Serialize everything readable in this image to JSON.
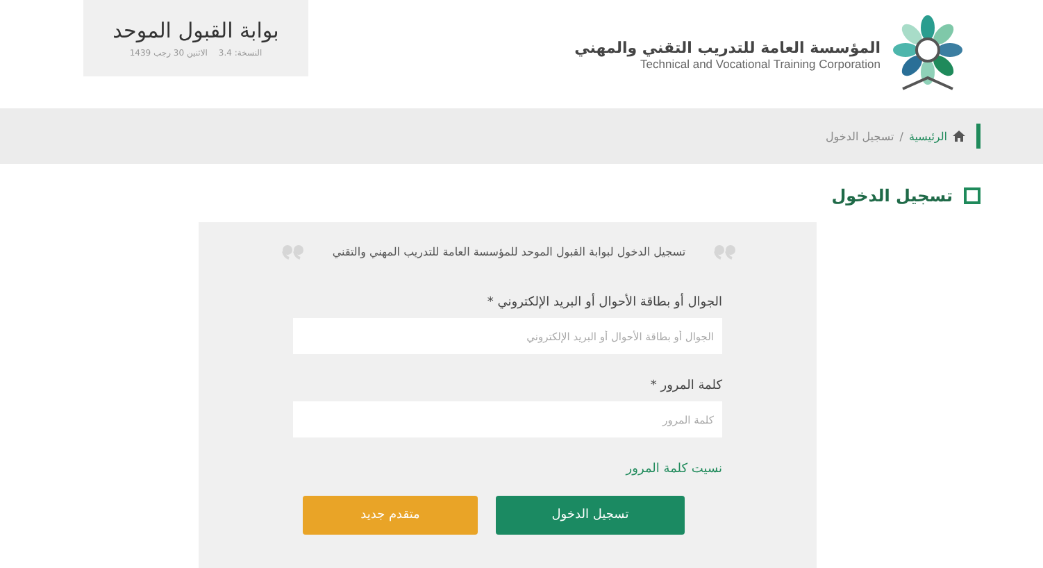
{
  "header": {
    "portal_title": "بوابة القبول الموحد",
    "version": "النسخة: 3.4",
    "date": "الاثنين 30 رجب 1439",
    "org_name_ar": "المؤسسة العامة للتدريب التقني والمهني",
    "org_name_en": "Technical and Vocational Training Corporation"
  },
  "breadcrumb": [
    {
      "label": "الرئيسية",
      "kind": "home"
    },
    {
      "label": "/",
      "kind": "separator"
    },
    {
      "label": "تسجيل الدخول",
      "kind": "current"
    }
  ],
  "page_title": "تسجيل الدخول",
  "intro": "تسجيل الدخول لبوابة القبول الموحد للمؤسسة العامة للتدريب المهني والتقني",
  "fields": [
    {
      "label": "الجوال أو بطاقة الأحوال أو البريد الإلكتروني *",
      "placeholder": "الجوال أو بطاقة الأحوال أو البريد الإلكتروني"
    },
    {
      "label": "كلمة المرور *",
      "placeholder": "كلمة المرور"
    }
  ],
  "forgot_link": "نسيت كلمة المرور",
  "buttons": [
    {
      "label": "تسجيل الدخول",
      "kind": "primary"
    },
    {
      "label": "متقدم جديد",
      "kind": "secondary"
    }
  ]
}
